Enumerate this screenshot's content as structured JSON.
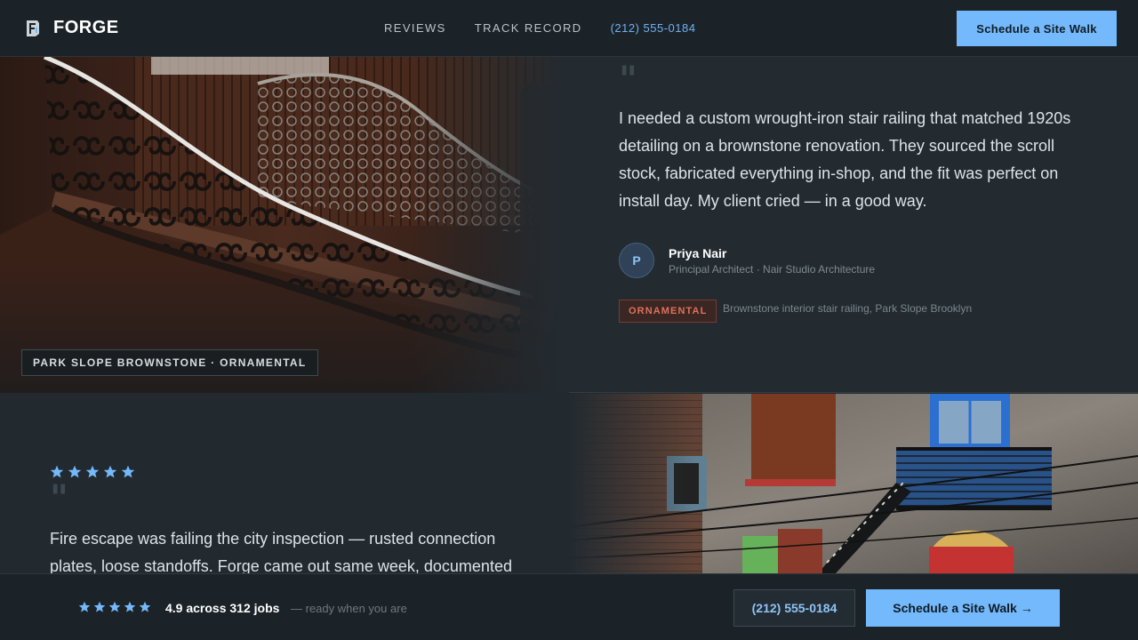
{
  "header": {
    "brand": "FORGE",
    "nav": [
      {
        "label": "REVIEWS"
      },
      {
        "label": "TRACK RECORD"
      },
      {
        "label": "(212) 555-0184"
      }
    ],
    "cta_label": "Schedule a Site Walk"
  },
  "review1": {
    "photo_caption": "PARK SLOPE BROWNSTONE · ORNAMENTAL",
    "quote_mark": "\"",
    "text": "I needed a custom wrought-iron stair railing that matched 1920s detailing on a brownstone renovation. They sourced the scroll stock, fabricated everything in-shop, and the fit was perfect on install day. My client cried — in a good way.",
    "avatar_initial": "P",
    "author_name": "Priya Nair",
    "author_role": "Principal Architect · Nair Studio Architecture",
    "tag": "ORNAMENTAL",
    "tag_desc": "Brownstone interior stair railing, Park Slope Brooklyn"
  },
  "review2": {
    "stars": 5,
    "quote_mark": "\"",
    "text": "Fire escape was failing the city inspection — rusted connection plates, loose standoffs. Forge came out same week, documented"
  },
  "bottombar": {
    "stars": 5,
    "rating": "4.9 across 312 jobs",
    "note": "— ready when you are",
    "phone_label": "(212) 555-0184",
    "cta_label": "Schedule a Site Walk →"
  },
  "colors": {
    "accent": "#74b9fb",
    "tag": "#e0715a",
    "background": "#222a30"
  },
  "icons": [
    "forge-logo-icon",
    "star-icon"
  ]
}
